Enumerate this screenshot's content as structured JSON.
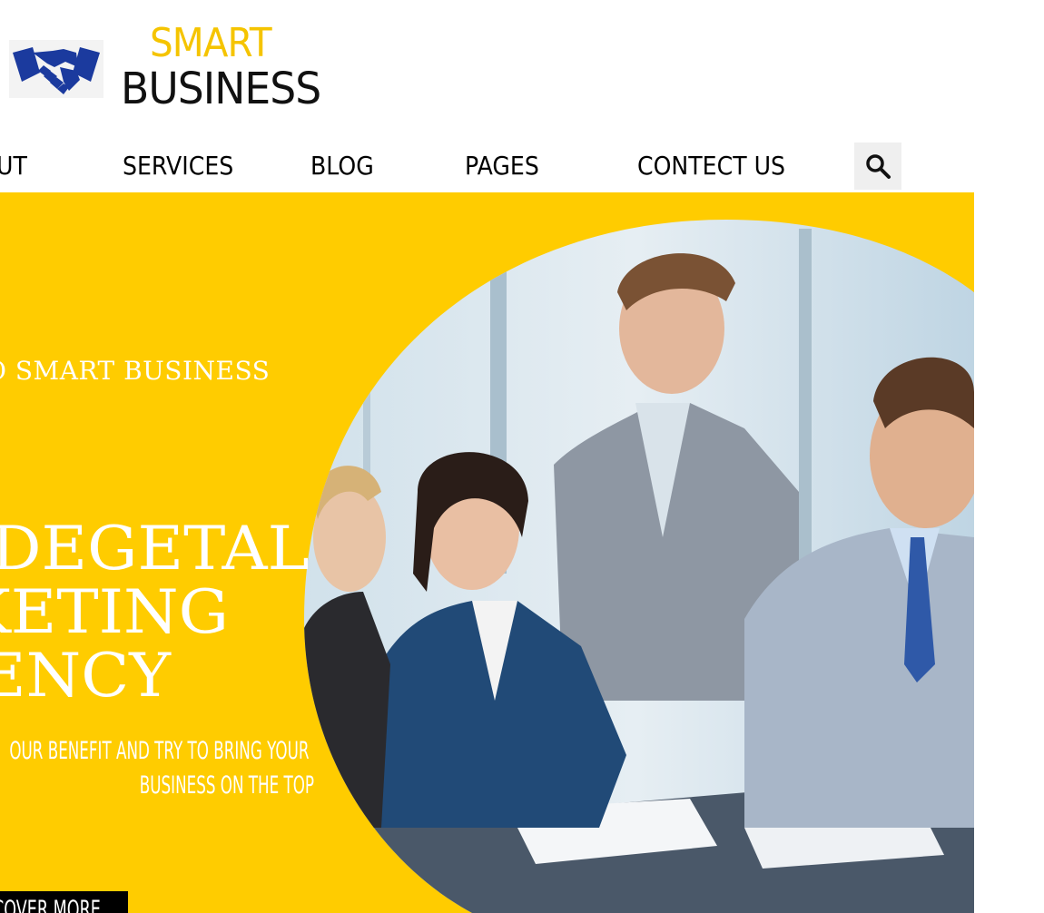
{
  "colors": {
    "accent": "#FFCC00",
    "brand_blue": "#1B3A9E",
    "text_dark": "#111111",
    "cta_bg": "#000000"
  },
  "logo": {
    "icon": "handshake-icon",
    "line1": "SMART",
    "line2": "BUSINESS"
  },
  "nav": {
    "items": [
      {
        "label": "UT"
      },
      {
        "label": "SERVICES"
      },
      {
        "label": "BLOG"
      },
      {
        "label": "PAGES"
      },
      {
        "label": "CONTECT US"
      }
    ],
    "search_icon": "search-icon"
  },
  "hero": {
    "welcome": "O SMART BUSINESS",
    "headline": [
      "DEGETAL",
      "KETING",
      "ENCY"
    ],
    "subtitle": [
      "OUR BENEFIT AND TRY TO BRING YOUR",
      "BUSINESS ON THE TOP"
    ],
    "cta_label": "COVER MORE"
  }
}
